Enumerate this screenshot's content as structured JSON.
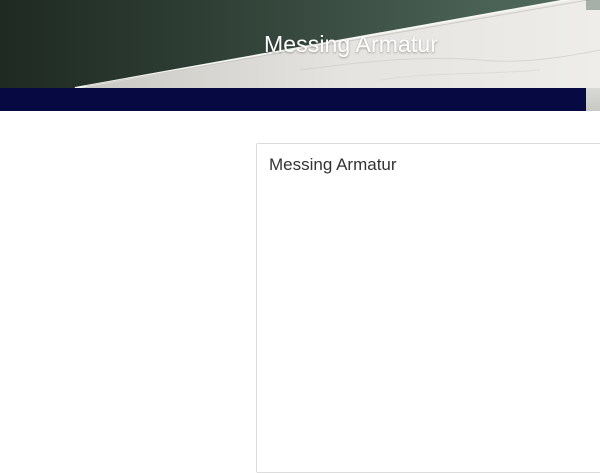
{
  "header": {
    "title": "Messing Armatur"
  },
  "card": {
    "title": "Messing Armatur"
  },
  "colors": {
    "nav_bar": "#070a42",
    "header_dark": "#1e2a22",
    "header_light": "#557064",
    "marble": "#e7e6e2",
    "card_border": "#dcdcdc",
    "text_dark": "#333333"
  }
}
